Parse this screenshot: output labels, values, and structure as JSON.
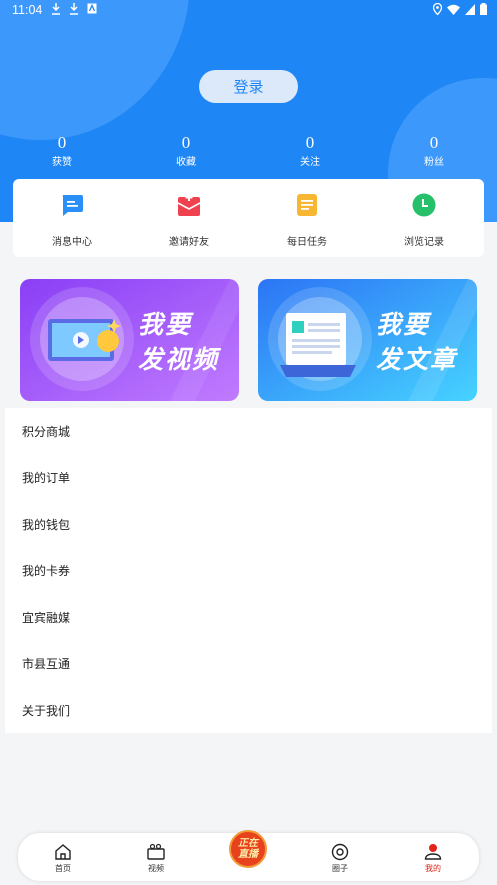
{
  "status_bar": {
    "time": "11:04"
  },
  "header": {
    "login_label": "登录"
  },
  "stats": [
    {
      "value": "0",
      "label": "获赞"
    },
    {
      "value": "0",
      "label": "收藏"
    },
    {
      "value": "0",
      "label": "关注"
    },
    {
      "value": "0",
      "label": "粉丝"
    }
  ],
  "quick_actions": [
    {
      "label": "消息中心",
      "icon": "message-icon",
      "color": "#2a8ff7"
    },
    {
      "label": "邀请好友",
      "icon": "gift-icon",
      "color": "#f0424e"
    },
    {
      "label": "每日任务",
      "icon": "task-icon",
      "color": "#f7b733"
    },
    {
      "label": "浏览记录",
      "icon": "clock-icon",
      "color": "#26c06a"
    }
  ],
  "banners": {
    "video": {
      "line1": "我要",
      "line2": "发视频"
    },
    "article": {
      "line1": "我要",
      "line2": "发文章"
    }
  },
  "menu": [
    "积分商城",
    "我的订单",
    "我的钱包",
    "我的卡券",
    "宜宾融媒",
    "市县互通",
    "关于我们"
  ],
  "bottom_nav": {
    "items": [
      {
        "label": "首页",
        "icon": "home-icon"
      },
      {
        "label": "视频",
        "icon": "video-camera-icon"
      },
      {
        "label": "圈子",
        "icon": "circle-icon"
      },
      {
        "label": "我的",
        "icon": "profile-icon",
        "active": true
      }
    ],
    "live_line1": "正在",
    "live_line2": "直播"
  },
  "colors": {
    "primary": "#1f86f6",
    "active_nav": "#e2231a"
  }
}
